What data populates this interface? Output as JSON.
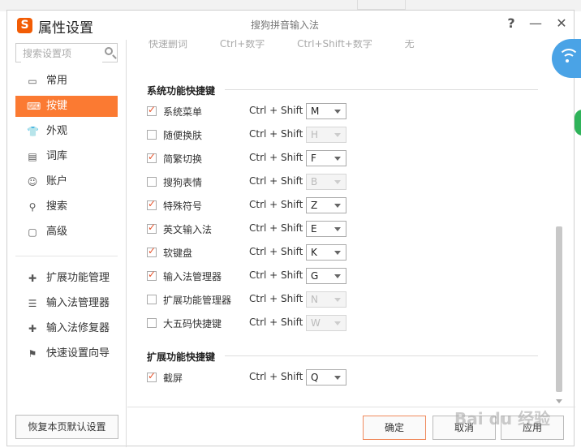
{
  "window": {
    "app_title": "属性设置",
    "logo_text": "S",
    "center_title": "搜狗拼音输入法",
    "help": "?",
    "minimize": "—",
    "close": "✕"
  },
  "search": {
    "placeholder": "搜索设置项"
  },
  "sidebar": {
    "items": [
      {
        "label": "常用",
        "icon": "monitor-icon",
        "glyph": "▭"
      },
      {
        "label": "按键",
        "icon": "keyboard-icon",
        "glyph": "⌨"
      },
      {
        "label": "外观",
        "icon": "shirt-icon",
        "glyph": "👕"
      },
      {
        "label": "词库",
        "icon": "book-icon",
        "glyph": "▤"
      },
      {
        "label": "账户",
        "icon": "user-icon",
        "glyph": "☺"
      },
      {
        "label": "搜索",
        "icon": "search-icon",
        "glyph": "⚲"
      },
      {
        "label": "高级",
        "icon": "advanced-icon",
        "glyph": "▢"
      }
    ],
    "tools": [
      {
        "label": "扩展功能管理",
        "icon": "puzzle-icon",
        "glyph": "✚"
      },
      {
        "label": "输入法管理器",
        "icon": "list-icon",
        "glyph": "☰"
      },
      {
        "label": "输入法修复器",
        "icon": "repair-kit-icon",
        "glyph": "✚"
      },
      {
        "label": "快速设置向导",
        "icon": "flag-icon",
        "glyph": "⚑"
      }
    ],
    "reset_button": "恢复本页默认设置"
  },
  "content": {
    "partial_row": {
      "label": "快速删词",
      "opt1": "Ctrl+数字",
      "opt2": "Ctrl+Shift+数字",
      "opt3": "无"
    },
    "system_section": {
      "title": "系统功能快捷键",
      "prefix": "Ctrl + Shift +",
      "rows": [
        {
          "label": "系统菜单",
          "checked": true,
          "key": "M"
        },
        {
          "label": "随便换肤",
          "checked": false,
          "key": "H"
        },
        {
          "label": "简繁切换",
          "checked": true,
          "key": "F"
        },
        {
          "label": "搜狗表情",
          "checked": false,
          "key": "B"
        },
        {
          "label": "特殊符号",
          "checked": true,
          "key": "Z"
        },
        {
          "label": "英文输入法",
          "checked": true,
          "key": "E"
        },
        {
          "label": "软键盘",
          "checked": true,
          "key": "K"
        },
        {
          "label": "输入法管理器",
          "checked": true,
          "key": "G"
        },
        {
          "label": "扩展功能管理器",
          "checked": false,
          "key": "N"
        },
        {
          "label": "大五码快捷键",
          "checked": false,
          "key": "W"
        }
      ]
    },
    "extension_section": {
      "title": "扩展功能快捷键",
      "prefix": "Ctrl + Shift +",
      "rows": [
        {
          "label": "截屏",
          "checked": true,
          "key": "Q"
        }
      ]
    }
  },
  "footer": {
    "ok": "确定",
    "cancel": "取消",
    "apply": "应用"
  },
  "watermark": "Bai du 经验"
}
